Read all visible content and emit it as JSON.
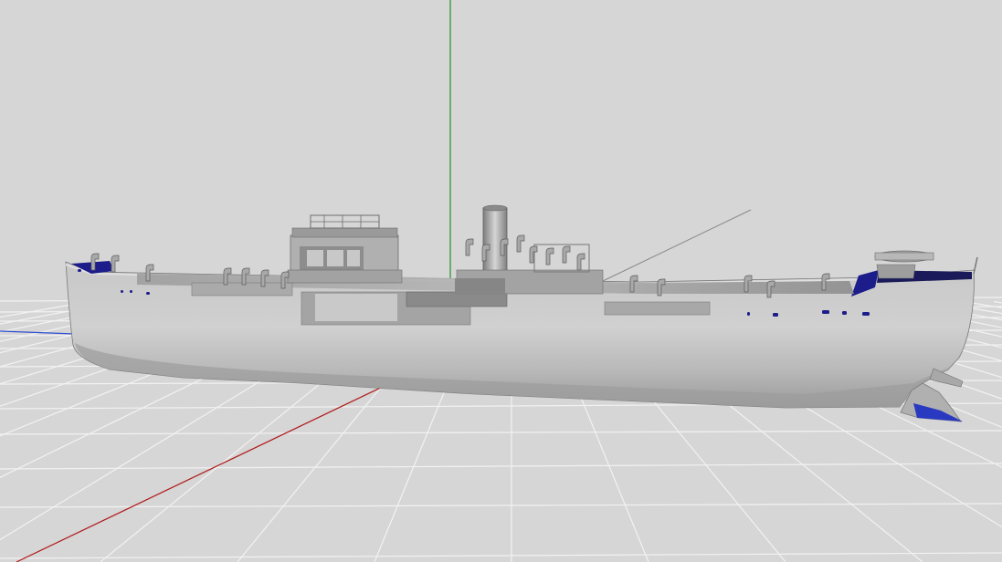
{
  "viewport": {
    "background": "#d6d6d6",
    "grid_color": "#f2f2f2",
    "axes": {
      "x_color": "#b01818",
      "y_color": "#1f8f2a",
      "z_color": "#2f4fd0"
    }
  },
  "model": {
    "hull_color": "#bdbdbd",
    "shadow_color": "#8c8c8c",
    "accent_color": "#1c1c8a"
  }
}
